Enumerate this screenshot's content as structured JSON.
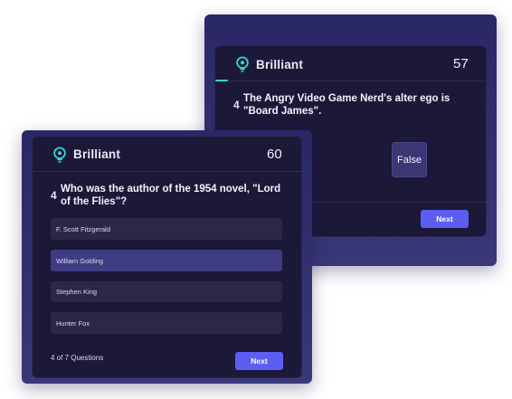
{
  "back_card": {
    "brand": "Brilliant",
    "timer": "57",
    "question_number": "4",
    "question_text": "The Angry Video Game Nerd's alter ego is \"Board James\".",
    "answer": "False",
    "next_label": "Next"
  },
  "front_card": {
    "brand": "Brilliant",
    "timer": "60",
    "question_number": "4",
    "question_text": "Who was the author of the 1954 novel, \"Lord of the Flies\"?",
    "options": [
      {
        "label": "F. Scott Fitzgerald",
        "selected": false
      },
      {
        "label": "William Golding",
        "selected": true
      },
      {
        "label": "Stephen King",
        "selected": false
      },
      {
        "label": "Hunter Fox",
        "selected": false
      }
    ],
    "progress_text": "4 of 7 Questions",
    "next_label": "Next"
  },
  "colors": {
    "frame": "#2f2c6d",
    "card": "#1b1838",
    "accent": "#5b5ef1",
    "selected": "#3f3c84",
    "logo": "#39d3d3"
  },
  "icons": {
    "logo": "lightbulb-icon"
  }
}
